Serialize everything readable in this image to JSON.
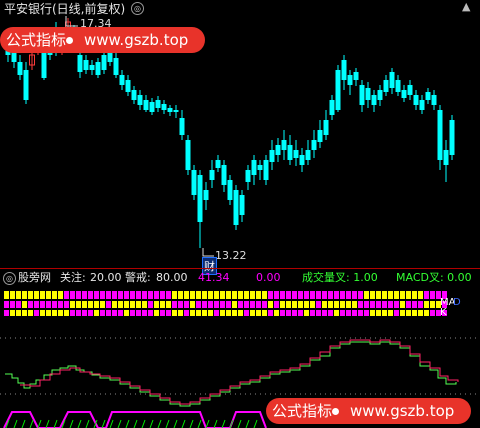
{
  "header": {
    "title": "平安银行(日线,前复权)",
    "circle_btn": "◎",
    "corner_icon": "▲"
  },
  "price_chart": {
    "high_label": "17.34",
    "low_label": "13.22",
    "marker_text": "财"
  },
  "watermark": {
    "left_text": "公式指标",
    "right_text": "www.gszb.top"
  },
  "indicator_bar": {
    "circle_btn": "◎",
    "name": "股旁网",
    "param1_label": "关注:",
    "param1_value": "20.00",
    "param2_label": "警戒:",
    "param2_value": "80.00",
    "value1": "41.34",
    "value2": "0.00",
    "vol_cross": "成交量叉: 1.00",
    "macd_cross": "MACD叉: 0.00"
  },
  "right_labels": {
    "ma": "MA",
    "ma_suffix": "D",
    "k": "K"
  },
  "colors": {
    "up": "#ff3b3b",
    "down": "#00ffff",
    "yellow": "#ffff00",
    "magenta": "#ff00ff",
    "green": "#00ff00"
  }
}
